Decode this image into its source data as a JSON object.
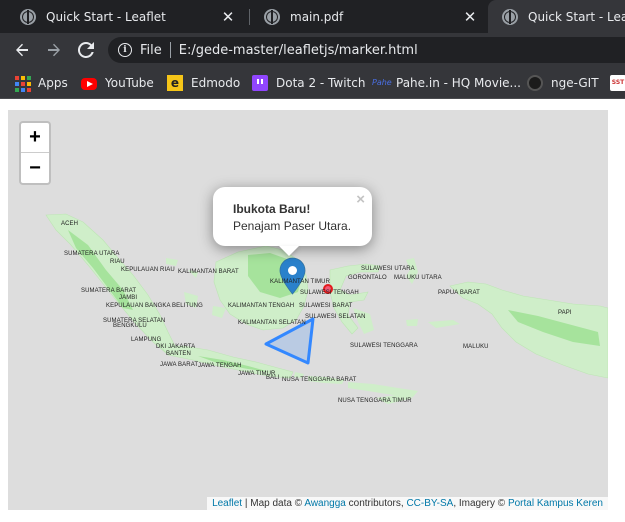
{
  "tabs": [
    {
      "title": "Quick Start - Leaflet",
      "icon": "globe-icon",
      "active": false
    },
    {
      "title": "main.pdf",
      "icon": "globe-icon",
      "active": false
    },
    {
      "title": "Quick Start - Leaflet",
      "icon": "globe-icon",
      "active": true
    }
  ],
  "toolbar": {
    "scheme": "File",
    "url": "E:/gede-master/leafletjs/marker.html"
  },
  "bookmarks": [
    {
      "label": "Apps",
      "icon": "apps-grid-icon"
    },
    {
      "label": "YouTube",
      "icon": "youtube-icon"
    },
    {
      "label": "Edmodo",
      "icon": "edmodo-icon"
    },
    {
      "label": "Dota 2 - Twitch",
      "icon": "twitch-icon"
    },
    {
      "label": "Pahe.in - HQ Movie...",
      "icon": "pahe-icon",
      "icon_text": "Pahe"
    },
    {
      "label": "nge-GIT",
      "icon": "github-icon"
    },
    {
      "label": "",
      "icon": "sst-icon",
      "icon_text": "SST"
    }
  ],
  "map": {
    "zoom_in": "+",
    "zoom_out": "−",
    "popup": {
      "title": "Ibukota Baru!",
      "body": "Penajam Paser Utara.",
      "close": "×"
    },
    "marker_color": "#2a81cb",
    "circle_color": "#e31a1c",
    "polygon_color": "#3388ff",
    "labels": [
      "ACEH",
      "SUMATERA UTARA",
      "RIAU",
      "KEPULAUAN RIAU",
      "SUMATERA BARAT",
      "JAMBI",
      "KEPULAUAN BANGKA BELITUNG",
      "SUMATERA SELATAN",
      "BENGKULU",
      "LAMPUNG",
      "DKI JAKARTA",
      "BANTEN",
      "JAWA BARAT",
      "JAWA TENGAH",
      "JAWA TIMUR",
      "BALI",
      "NUSA TENGGARA BARAT",
      "NUSA TENGGARA TIMUR",
      "KALIMANTAN BARAT",
      "KALIMANTAN TENGAH",
      "KALIMANTAN SELATAN",
      "KALIMANTAN TIMUR",
      "SULAWESI BARAT",
      "SULAWESI SELATAN",
      "SULAWESI TENGAH",
      "SULAWESI TENGGARA",
      "SULAWESI UTARA",
      "GORONTALO",
      "MALUKU UTARA",
      "MALUKU",
      "PAPUA BARAT",
      "PAPI"
    ],
    "attribution": {
      "leaflet": "Leaflet",
      "sep1": " | Map data © ",
      "awangga": "Awangga",
      "contrib": " contributors, ",
      "license": "CC-BY-SA",
      "imagery": ", Imagery © ",
      "portal": "Portal Kampus Keren"
    }
  }
}
